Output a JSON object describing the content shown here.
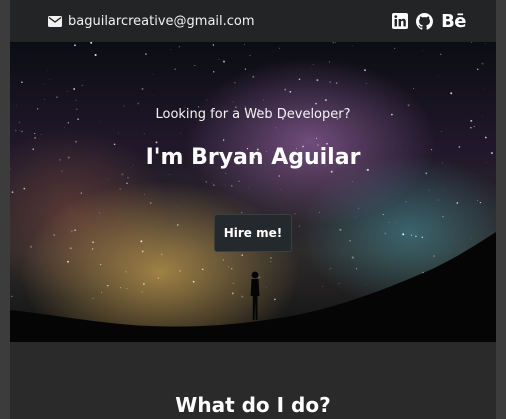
{
  "header": {
    "email": "baguilarcreative@gmail.com",
    "socials": [
      {
        "name": "LinkedIn",
        "icon": "linkedin-icon"
      },
      {
        "name": "GitHub",
        "icon": "github-icon"
      },
      {
        "name": "Behance",
        "icon": "behance-icon",
        "glyph": "Bē"
      }
    ]
  },
  "hero": {
    "tagline": "Looking for a Web Developer?",
    "name": "I'm Bryan Aguilar",
    "cta_label": "Hire me!"
  },
  "sections": {
    "what_title": "What do I do?"
  },
  "colors": {
    "topbar": "#222426",
    "page_bg": "#2a2a2a",
    "button_bg": "#24292e"
  }
}
